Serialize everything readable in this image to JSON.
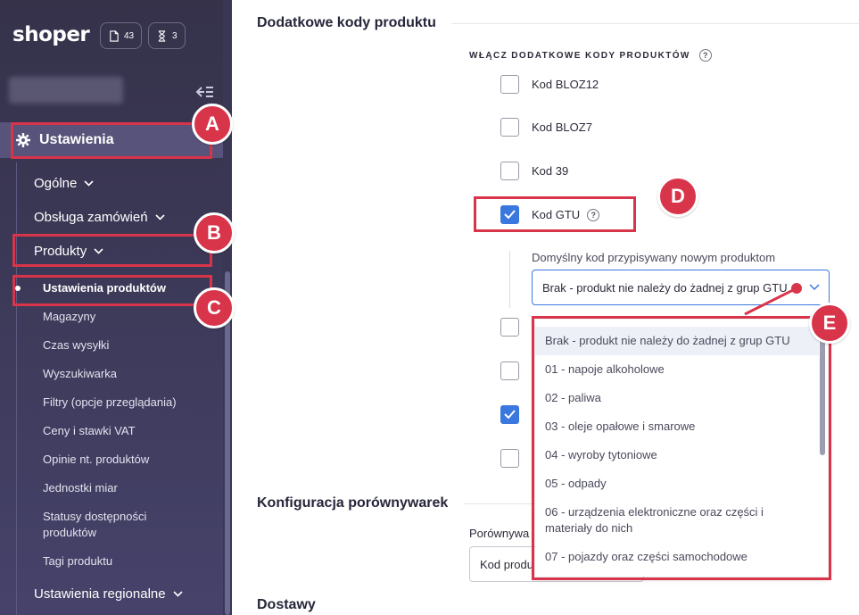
{
  "sidebar": {
    "logo": "shoper",
    "badge_pages": "43",
    "badge_tasks": "3",
    "settings_label": "Ustawienia",
    "menu": [
      {
        "label": "Ogólne"
      },
      {
        "label": "Obsługa zamówień"
      },
      {
        "label": "Produkty"
      }
    ],
    "submenu": [
      {
        "label": "Ustawienia produktów"
      },
      {
        "label": "Magazyny"
      },
      {
        "label": "Czas wysyłki"
      },
      {
        "label": "Wyszukiwarka"
      },
      {
        "label": "Filtry (opcje przeglądania)"
      },
      {
        "label": "Ceny i stawki VAT"
      },
      {
        "label": "Opinie nt. produktów"
      },
      {
        "label": "Jednostki miar"
      },
      {
        "label": "Statusy dostępności produktów"
      },
      {
        "label": "Tagi produktu"
      }
    ],
    "regional_label": "Ustawienia regionalne"
  },
  "main": {
    "section1_title": "Dodatkowe kody produktu",
    "group_label": "WŁĄCZ DODATKOWE KODY PRODUKTÓW",
    "codes": [
      {
        "label": "Kod BLOZ12",
        "checked": false
      },
      {
        "label": "Kod BLOZ7",
        "checked": false
      },
      {
        "label": "Kod 39",
        "checked": false
      },
      {
        "label": "Kod GTU",
        "checked": true
      }
    ],
    "default_code_label": "Domyślny kod przypisywany nowym produktom",
    "default_code_value": "Brak - produkt nie należy do żadnej z grup GTU",
    "gtu_options": [
      "Brak - produkt nie należy do żadnej z grup GTU",
      "01 - napoje alkoholowe",
      "02 - paliwa",
      "03 - oleje opałowe i smarowe",
      "04 - wyroby tytoniowe",
      "05 - odpady",
      "06 - urządzenia elektroniczne oraz części i materiały do nich",
      "07 - pojazdy oraz części samochodowe"
    ],
    "section2_title": "Konfiguracja porównywarek",
    "comparators_label": "Porównywa",
    "comparators_value": "Kod produ",
    "section3_title": "Dostawy"
  },
  "annotations": {
    "a": "A",
    "b": "B",
    "c": "C",
    "d": "D",
    "e": "E",
    "color": "#d8344a"
  },
  "colors": {
    "sidebar": "#3c3958",
    "accent": "#3a78e0"
  }
}
